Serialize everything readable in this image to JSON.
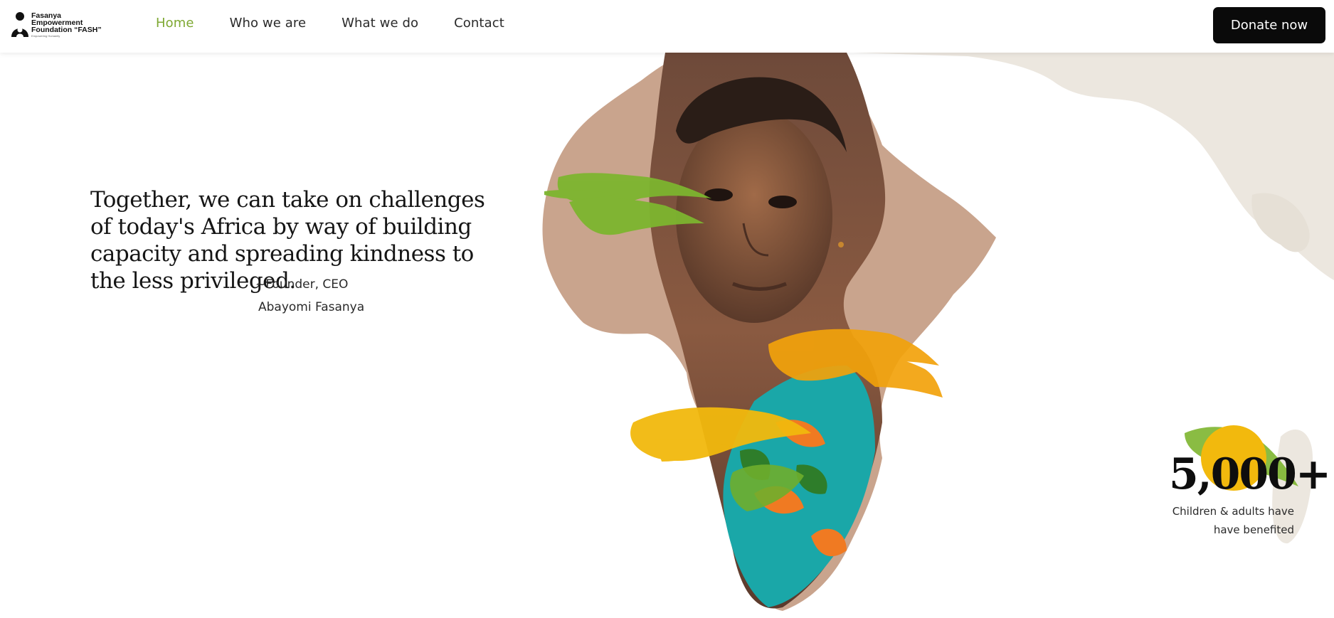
{
  "header": {
    "logo": {
      "lines": [
        "Fasanya",
        "Empowerment",
        "Foundation “FASH”"
      ],
      "tagline": "Empowering Humanity"
    },
    "nav": [
      {
        "label": "Home",
        "active": true
      },
      {
        "label": "Who we are",
        "active": false
      },
      {
        "label": "What we do",
        "active": false
      },
      {
        "label": "Contact",
        "active": false
      }
    ],
    "donate_label": "Donate now"
  },
  "hero": {
    "quote": "Together, we can take on challenges of today's Africa by way of building capacity and spreading kindness to the less privileged.",
    "attribution_role": "~Founder, CEO",
    "attribution_name": "Abayomi Fasanya"
  },
  "stats": {
    "value": "5,000+",
    "label_line1": "Children & adults have",
    "label_line2": "have benefited"
  },
  "colors": {
    "accent_green": "#7ea832",
    "accent_yellow": "#f2b90d",
    "map_bg": "#ece7df",
    "button_bg": "#0a0a0a"
  }
}
